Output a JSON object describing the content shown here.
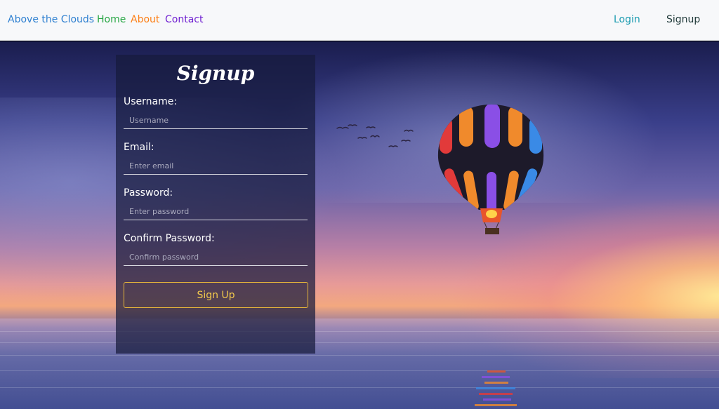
{
  "navbar": {
    "brand": "Above the Clouds",
    "links": [
      {
        "label": "Home",
        "color": "#28a745"
      },
      {
        "label": "About",
        "color": "#fd7e14"
      },
      {
        "label": "Contact",
        "color": "#6f1fd1"
      }
    ],
    "login": "Login",
    "signup": "Signup"
  },
  "colors": {
    "brand": "#2d7fd0",
    "login": "#1a9bb0",
    "signup": "#203a3a",
    "accent_button": "#e8b73a"
  },
  "form": {
    "title": "Signup",
    "fields": [
      {
        "label": "Username:",
        "placeholder": "Username",
        "value": ""
      },
      {
        "label": "Email:",
        "placeholder": "Enter email",
        "value": ""
      },
      {
        "label": "Password:",
        "placeholder": "Enter password",
        "value": ""
      },
      {
        "label": "Confirm Password:",
        "placeholder": "Confirm password",
        "value": ""
      }
    ],
    "submit_label": "Sign Up"
  },
  "icons": {
    "balloon": "hot-air-balloon",
    "birds": "birds-flock"
  }
}
